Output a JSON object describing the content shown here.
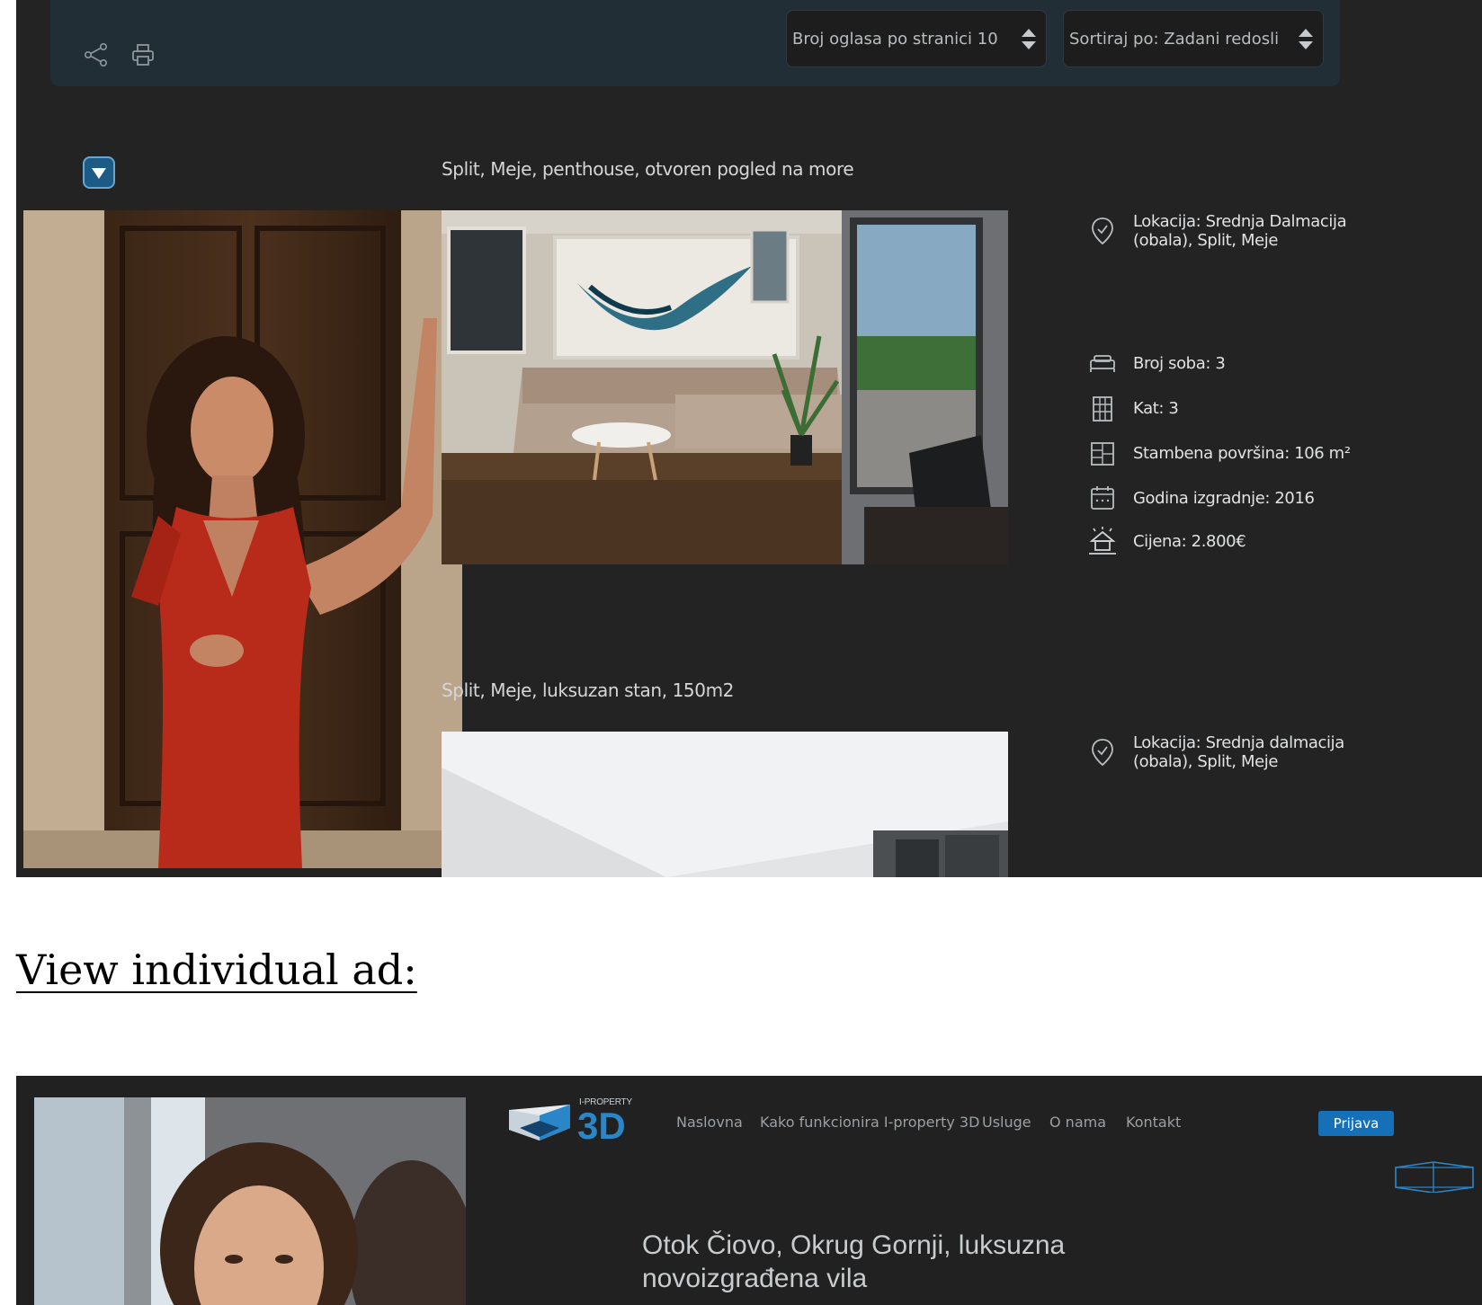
{
  "listing_page": {
    "toolbar": {
      "share_icon": "share-icon",
      "print_icon": "printer-icon",
      "per_page_select": "Broj oglasa po stranici 10",
      "sort_select": "Sortiraj po: Zadani redosli"
    },
    "listings": [
      {
        "title": "Split, Meje, penthouse, otvoren pogled na more",
        "location_line1": "Lokacija: Srednja Dalmacija",
        "location_line2": "(obala), Split, Meje",
        "rooms": "Broj soba: 3",
        "floor": "Kat: 3",
        "area": "Stambena površina: 106 m²",
        "year_built": "Godina izgradnje: 2016",
        "price": "Cijena:  2.800€"
      },
      {
        "title": "Split, Meje, luksuzan stan, 150m2",
        "location_line1": "Lokacija: Srednja dalmacija",
        "location_line2": "(obala), Split, Meje"
      }
    ]
  },
  "caption": "View individual ad:",
  "ad_page": {
    "logo_small": "I-PROPERTY",
    "logo_big": "3D",
    "nav": [
      "Naslovna",
      "Kako funkcionira I-property 3D",
      "Usluge",
      "O nama",
      "Kontakt"
    ],
    "login": "Prijava",
    "title": "Otok Čiovo, Okrug Gornji, luksuzna novoizgrađena vila"
  },
  "colors": {
    "dark_bg": "#232323",
    "toolbar_bg": "#212e35",
    "accent_blue": "#1670b8",
    "logo_blue": "#2b86c8"
  }
}
